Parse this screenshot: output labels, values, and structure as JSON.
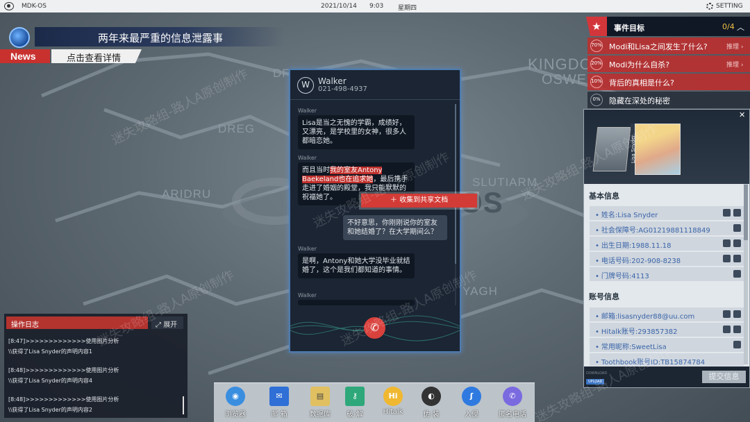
{
  "topbar": {
    "os_name": "MDK-OS",
    "date": "2021/10/14",
    "time": "9:03",
    "weekday": "星期四",
    "setting": "SETTING"
  },
  "map": {
    "labels": [
      "DREG",
      "ARIDRU",
      "SLUTIARM",
      "YAGH",
      "KINGDO",
      "OSWES",
      "OS",
      "DF",
      "OS"
    ]
  },
  "news": {
    "headline": "两年来最严重的信息泄露事",
    "tag": "News",
    "link": "点击查看详情"
  },
  "phone": {
    "contact": {
      "initial": "W",
      "name": "Walker",
      "number": "021-498-4937"
    },
    "messages": [
      {
        "sender": "Walker",
        "text": "Lisa是当之无愧的学霸，成绩好，又漂亮，是学校里的女神，很多人都暗恋她。"
      },
      {
        "sender": "Walker",
        "text_pre": "而且当时",
        "text_hl": "我的室友Antony Baekeland也在追求她",
        "text_post": "，最后携手走进了婚姻的殿堂，我只能默默的祝福她了。"
      },
      {
        "sender": "",
        "text": "不好意思，你刚刚说你的室友和她结婚了？在大学期间么？"
      },
      {
        "sender": "Walker",
        "text": "是啊，Antony和她大学没毕业就结婚了，这个是我们都知道的事情。"
      },
      {
        "sender": "Walker",
        "text": ""
      }
    ],
    "collect_button": "收集到共享文档",
    "hangup_icon": "phone-hangup-icon"
  },
  "events": {
    "title": "事件目标",
    "count": "0/4",
    "items": [
      {
        "pct": "70%",
        "question": "Modi和Lisa之间发生了什么?",
        "action": "推理"
      },
      {
        "pct": "20%",
        "question": "Modi为什么自杀?",
        "action": "推理"
      },
      {
        "pct": "10%",
        "question": "背后的真相是什么?",
        "action": ""
      },
      {
        "pct": "0%",
        "question": "隐藏在深处的秘密",
        "action": ""
      }
    ]
  },
  "profile": {
    "photo_tag": "Lisa Snyder",
    "basic_title": "基本信息",
    "basic": [
      "姓名:Lisa Snyder",
      "社会保障号:AG01219881118849",
      "出生日期:1988.11.18",
      "电话号码:202-908-8238",
      "门牌号码:4113"
    ],
    "account_title": "账号信息",
    "account": [
      "邮箱:lisasnyder88@uu.com",
      "Hitalk账号:293857382",
      "常用昵称:SweetLisa",
      "Toothbook账号ID:TB15874784"
    ],
    "download_label": "DOWNLOAD",
    "upload_label": "UPLOAD",
    "submit": "提交信息"
  },
  "log": {
    "title": "操作日志",
    "expand": "展开",
    "lines": [
      "[8:47]>>>>>>>>>>>>>使用图片分析",
      "\\\\获得了Lisa Snyder的声明内容1",
      "[8:48]>>>>>>>>>>>>>使用图片分析",
      "\\\\获得了Lisa Snyder的声明内容4",
      "[8:48]>>>>>>>>>>>>>使用图片分析",
      "\\\\获得了Lisa Snyder的声明内容2"
    ]
  },
  "dock": {
    "apps": [
      {
        "label": "浏览器",
        "icon": "globe-icon",
        "color": "#3a8ee0",
        "glyph": "◉"
      },
      {
        "label": "邮 箱",
        "icon": "mail-icon",
        "color": "#2f6fd6",
        "glyph": "✉"
      },
      {
        "label": "数据库",
        "icon": "database-icon",
        "color": "#e0c060",
        "glyph": "▤"
      },
      {
        "label": "破 解",
        "icon": "key-icon",
        "color": "#2ea87a",
        "glyph": "⚷"
      },
      {
        "label": "Hitalk",
        "icon": "hitalk-icon",
        "color": "#f0b830",
        "glyph": "Hi"
      },
      {
        "label": "伪 装",
        "icon": "disguise-icon",
        "color": "#333333",
        "glyph": "◐"
      },
      {
        "label": "入侵",
        "icon": "hook-icon",
        "color": "#2f7ae0",
        "glyph": "ʃ"
      },
      {
        "label": "匿名电话",
        "icon": "anon-phone-icon",
        "color": "#7a6ae0",
        "glyph": "✆"
      }
    ]
  },
  "watermark": "迷失攻略组-路人A原创制作"
}
